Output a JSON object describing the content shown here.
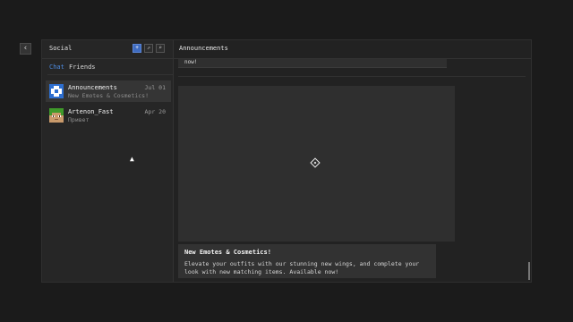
{
  "social": {
    "title": "Social",
    "tabs": [
      "Chat",
      "Friends"
    ],
    "buttons": {
      "add_friend": "+",
      "link": "⇗",
      "search": "⌕"
    }
  },
  "conversations": [
    {
      "name": "Announcements",
      "preview": "New Emotes & Cosmetics!",
      "date": "Jul 01",
      "avatar": "announcement-avatar"
    },
    {
      "name": "Artenon_Fast",
      "preview": "Привет",
      "date": "Apr 20",
      "avatar": "player-avatar"
    }
  ],
  "chat": {
    "title": "Announcements",
    "previous_message_tail": "now!",
    "message": {
      "title": "New Emotes & Cosmetics!",
      "body": "Elevate your outfits with our stunning new wings, and complete your look with new matching items. Available now!"
    }
  },
  "colors": {
    "accent": "#4d8be0",
    "background": "#1b1b1b",
    "panel": "#262626"
  }
}
